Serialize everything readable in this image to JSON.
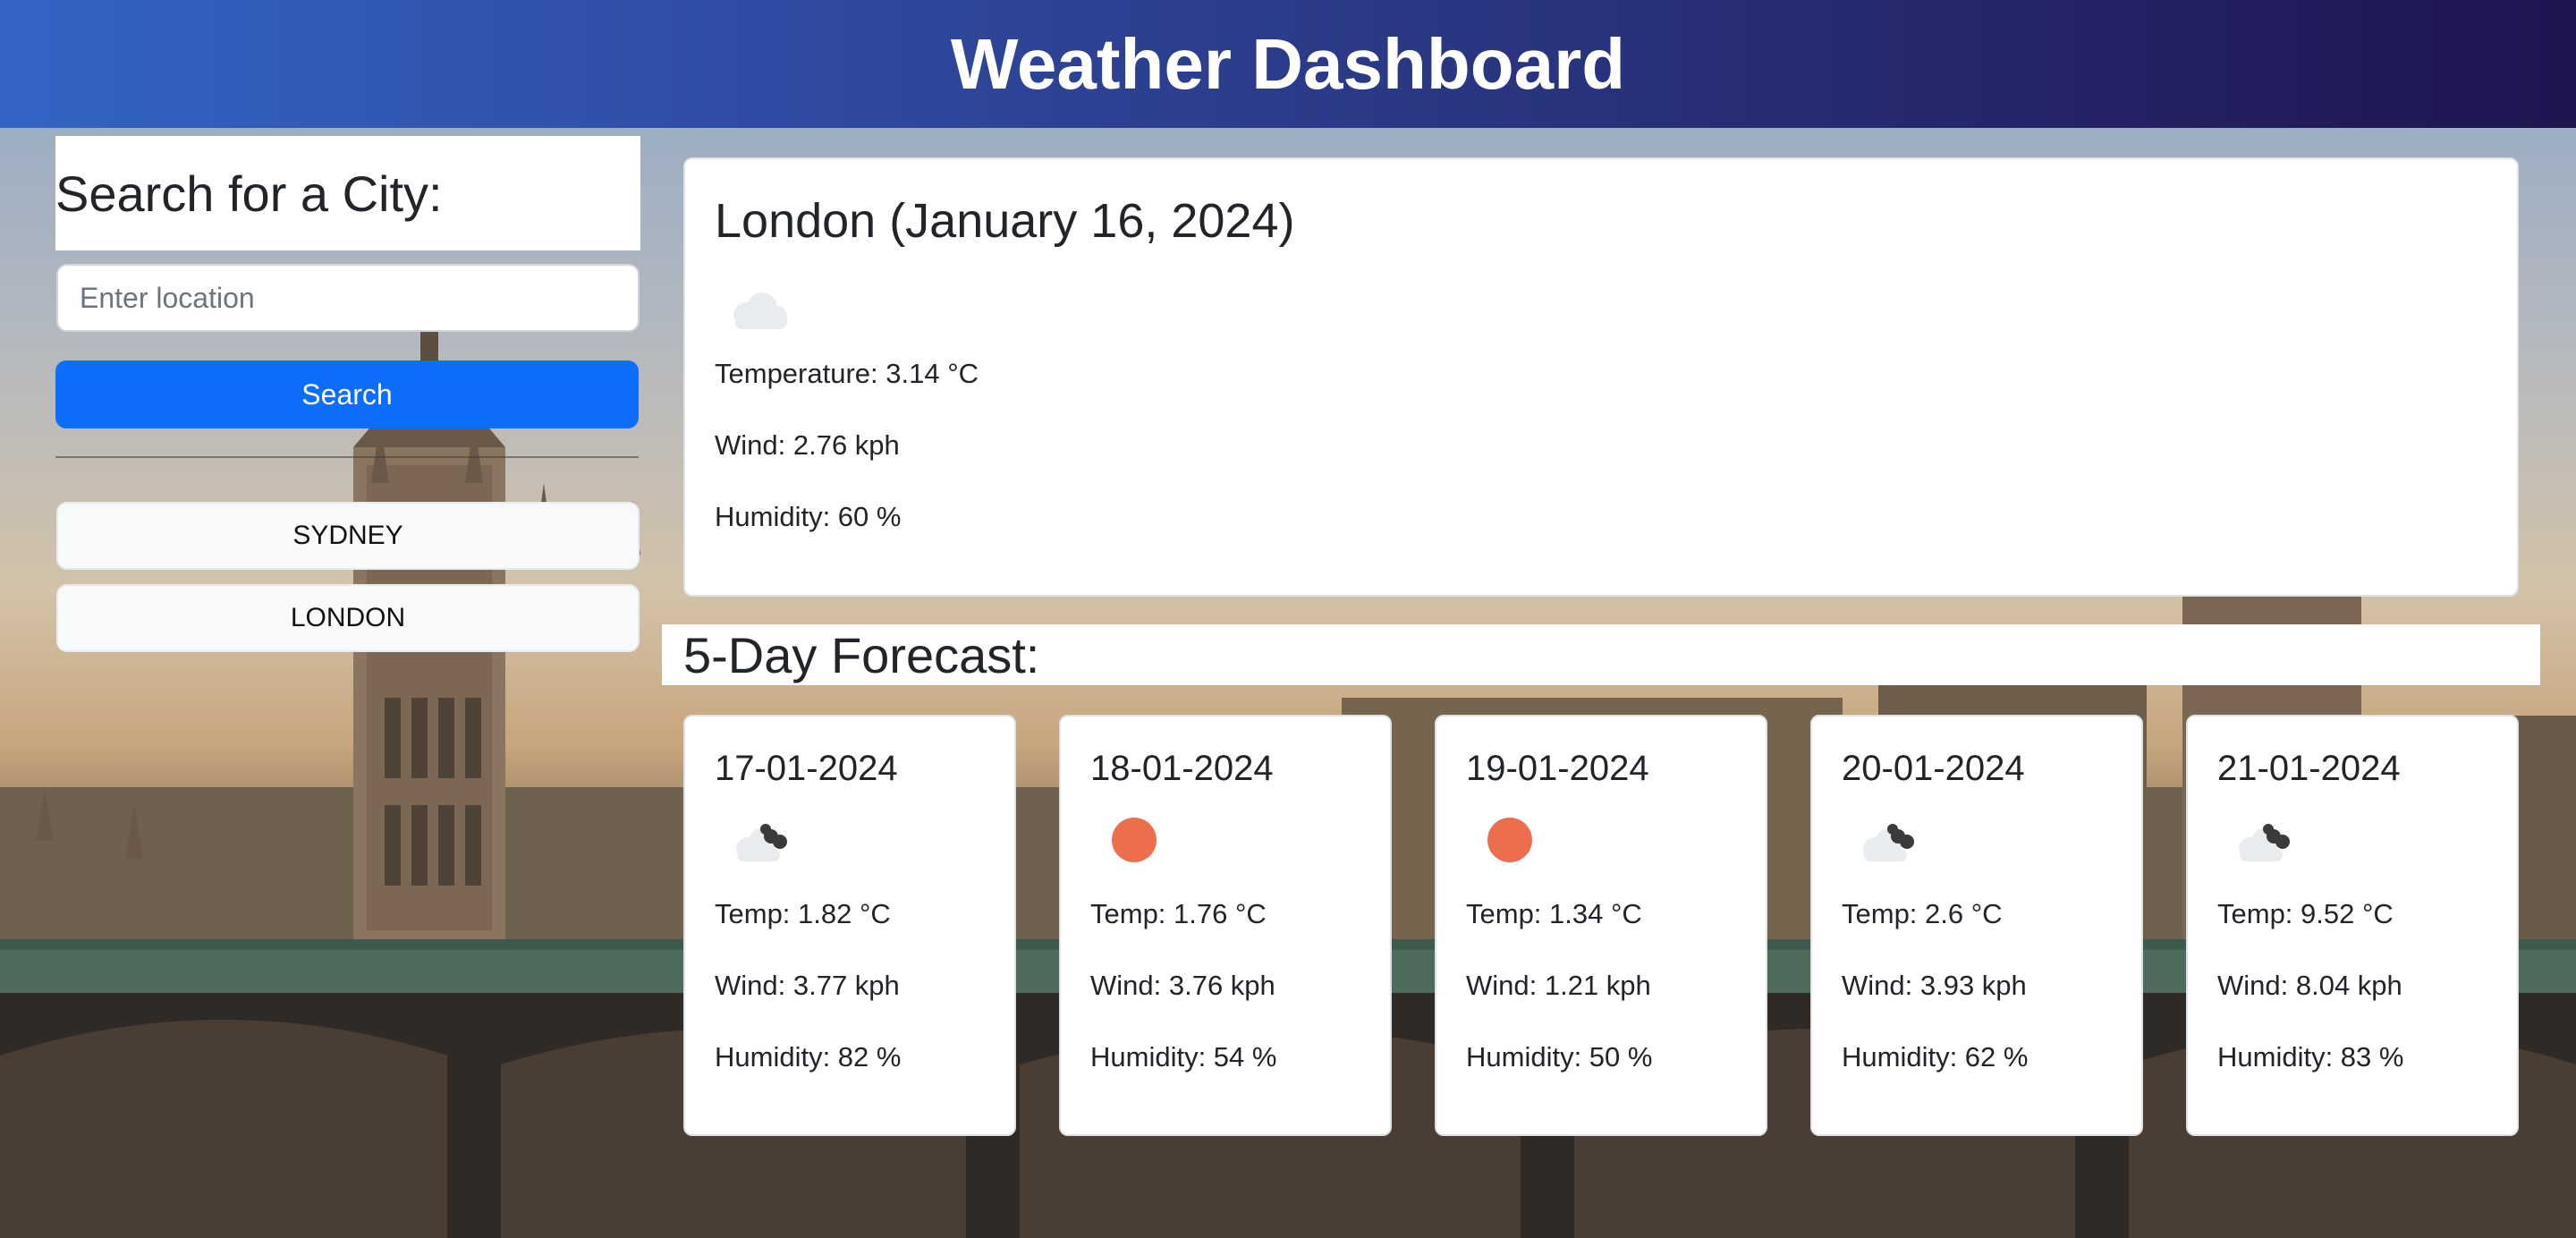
{
  "header": {
    "title": "Weather Dashboard"
  },
  "sidebar": {
    "heading": "Search for a City:",
    "search_placeholder": "Enter location",
    "search_value": "",
    "search_button": "Search",
    "history": [
      "SYDNEY",
      "LONDON"
    ]
  },
  "current": {
    "title": "London (January 16, 2024)",
    "icon": "cloud-icon",
    "temperature": "Temperature: 3.14 °C",
    "wind": "Wind: 2.76 kph",
    "humidity": "Humidity: 60 %"
  },
  "forecast": {
    "heading": "5-Day Forecast:",
    "days": [
      {
        "date": "17-01-2024",
        "icon": "cloudy-icon",
        "temp": "Temp: 1.82 °C",
        "wind": "Wind: 3.77 kph",
        "humidity": "Humidity: 82 %"
      },
      {
        "date": "18-01-2024",
        "icon": "sun-icon",
        "temp": "Temp: 1.76 °C",
        "wind": "Wind: 3.76 kph",
        "humidity": "Humidity: 54 %"
      },
      {
        "date": "19-01-2024",
        "icon": "sun-icon",
        "temp": "Temp: 1.34 °C",
        "wind": "Wind: 1.21 kph",
        "humidity": "Humidity: 50 %"
      },
      {
        "date": "20-01-2024",
        "icon": "cloudy-icon",
        "temp": "Temp: 2.6 °C",
        "wind": "Wind: 3.93 kph",
        "humidity": "Humidity: 62 %"
      },
      {
        "date": "21-01-2024",
        "icon": "cloudy-icon",
        "temp": "Temp: 9.52 °C",
        "wind": "Wind: 8.04 kph",
        "humidity": "Humidity: 83 %"
      }
    ]
  },
  "colors": {
    "header_start": "#3364c6",
    "header_end": "#1f1450",
    "primary_button": "#0d6efd",
    "sun": "#ec6e4c"
  }
}
